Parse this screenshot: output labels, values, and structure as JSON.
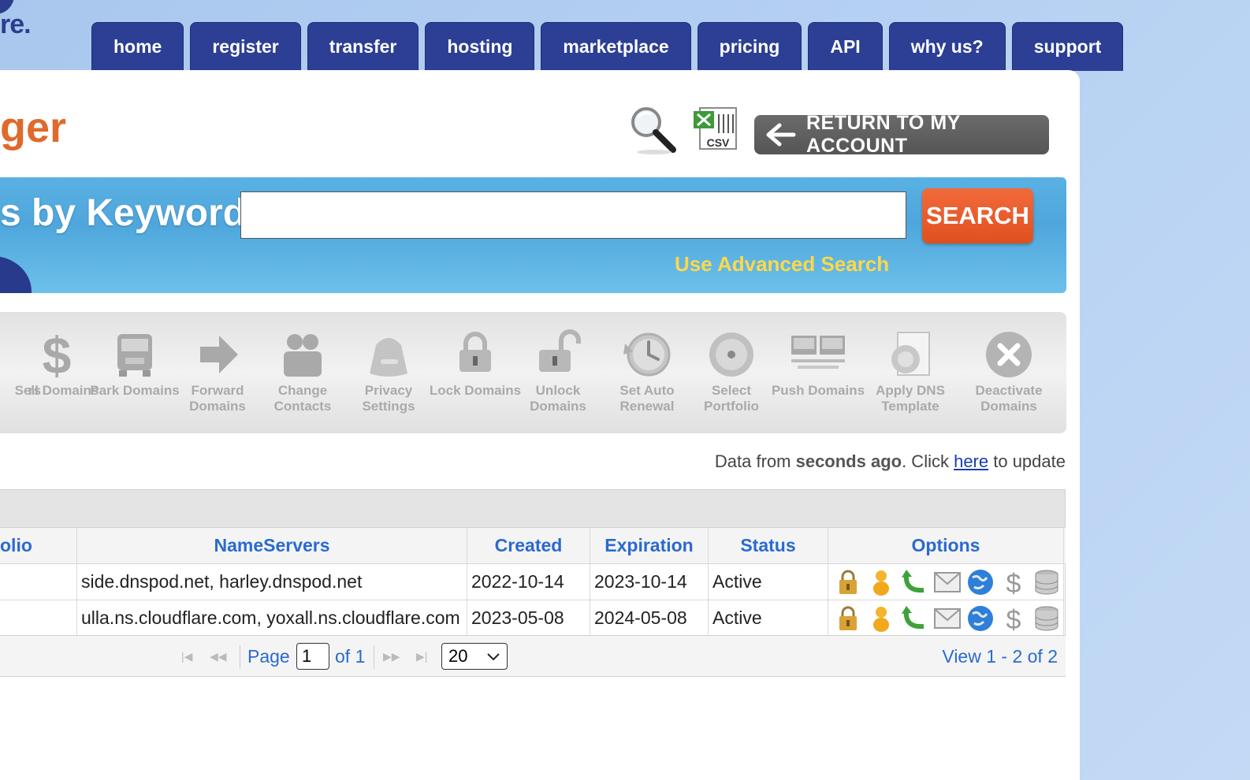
{
  "logo": {
    "text": "re."
  },
  "nav": {
    "tabs": [
      "home",
      "register",
      "transfer",
      "hosting",
      "marketplace",
      "pricing",
      "API",
      "why us?",
      "support"
    ]
  },
  "header": {
    "title": "ger",
    "return_button": "RETURN TO MY ACCOUNT",
    "csv_label": "CSV"
  },
  "keyword_search": {
    "label": "s by Keyword",
    "value": "",
    "button": "SEARCH",
    "advanced_link": "Use Advanced Search"
  },
  "toolbar": {
    "items": [
      {
        "label": "rs",
        "icon": "partial-icon"
      },
      {
        "label": "Sell Domains",
        "icon": "dollar-icon"
      },
      {
        "label": "Park Domains",
        "icon": "bus-icon"
      },
      {
        "label": "Forward Domains",
        "icon": "arrow-right-icon"
      },
      {
        "label": "Change Contacts",
        "icon": "contacts-icon"
      },
      {
        "label": "Privacy Settings",
        "icon": "privacy-bag-icon"
      },
      {
        "label": "Lock Domains",
        "icon": "lock-icon"
      },
      {
        "label": "Unlock Domains",
        "icon": "unlock-icon"
      },
      {
        "label": "Set Auto Renewal",
        "icon": "clock-icon"
      },
      {
        "label": "Select Portfolio",
        "icon": "disc-icon"
      },
      {
        "label": "Push Domains",
        "icon": "monitors-icon"
      },
      {
        "label": "Apply DNS Template",
        "icon": "dns-template-icon"
      },
      {
        "label": "Deactivate Domains",
        "icon": "deactivate-icon"
      }
    ]
  },
  "data_status": {
    "prefix": "Data from ",
    "bold": "seconds ago",
    "middle": ". Click ",
    "link": "here",
    "suffix": " to update"
  },
  "grid": {
    "columns": [
      "olio",
      "NameServers",
      "Created",
      "Expiration",
      "Status",
      "Options"
    ],
    "rows": [
      {
        "portfolio": "",
        "nameservers": "side.dnspod.net, harley.dnspod.net",
        "created": "2022-10-14",
        "expiration": "2023-10-14",
        "status": "Active"
      },
      {
        "portfolio": "",
        "nameservers": "ulla.ns.cloudflare.com, yoxall.ns.cloudflare.com",
        "created": "2023-05-08",
        "expiration": "2024-05-08",
        "status": "Active"
      }
    ],
    "option_icons": [
      "lock-icon",
      "contact-person-icon",
      "renew-arrow-icon",
      "mail-icon",
      "globe-icon",
      "dollar-icon",
      "database-icon"
    ]
  },
  "pager": {
    "page_label": "Page",
    "page_value": "1",
    "of_label": "of 1",
    "rows_per_page": "20",
    "view_text": "View 1 - 2 of 2"
  }
}
